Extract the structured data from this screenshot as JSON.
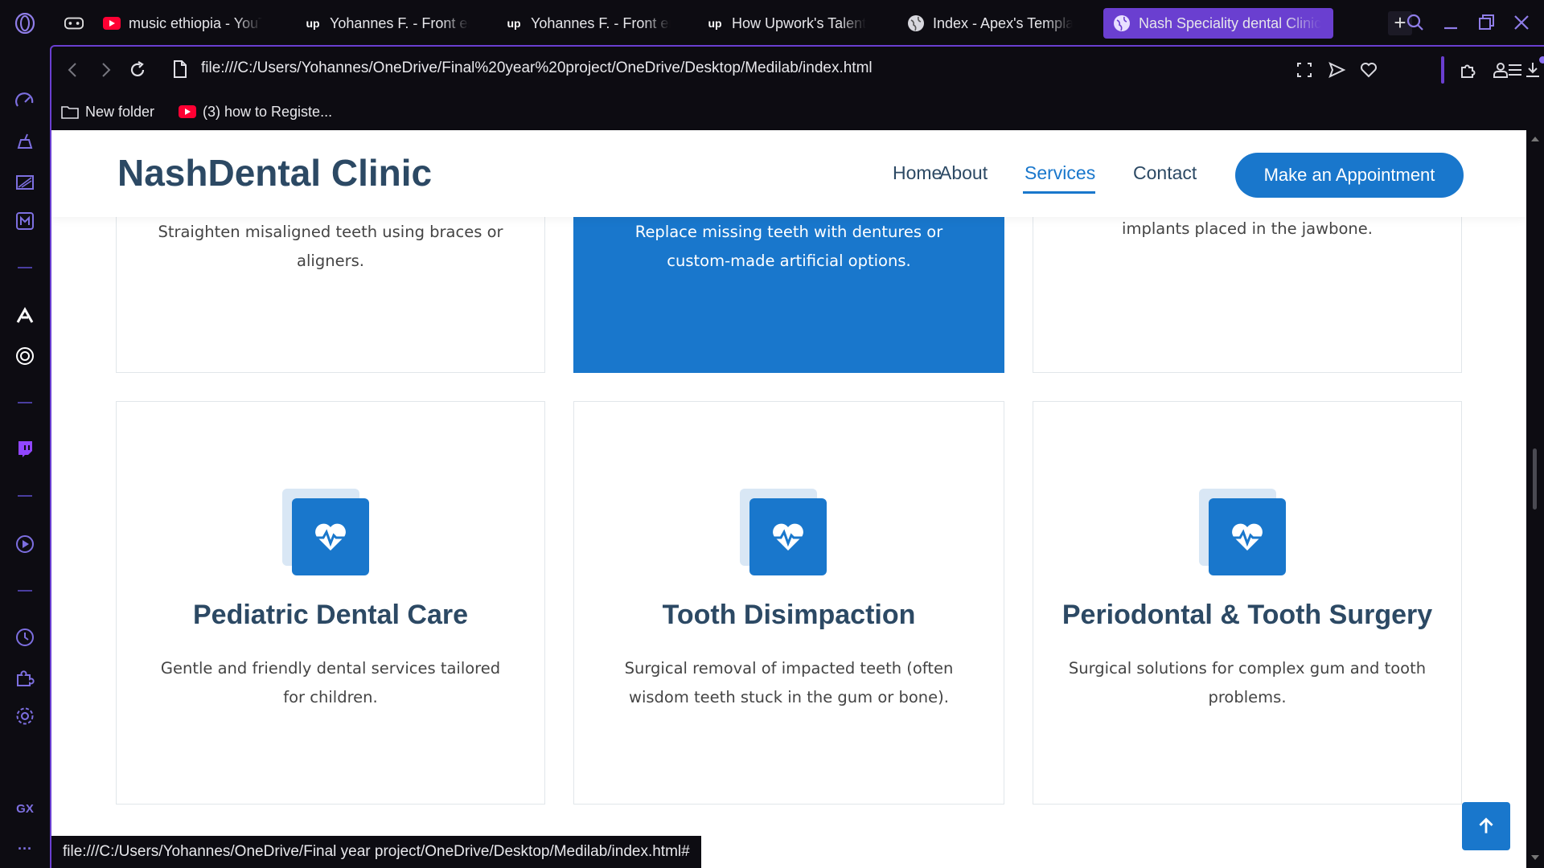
{
  "browser": {
    "tabs": [
      {
        "title": "music ethiopia - YouTube",
        "favicon": "youtube-icon",
        "active": false
      },
      {
        "title": "Yohannes F. - Front end",
        "favicon": "upwork-icon",
        "active": false
      },
      {
        "title": "Yohannes F. - Front end",
        "favicon": "upwork-icon",
        "active": false
      },
      {
        "title": "How Upwork's Talent",
        "favicon": "upwork-icon",
        "active": false
      },
      {
        "title": "Index - Apex's Template",
        "favicon": "globe-icon",
        "active": false
      },
      {
        "title": "Nash Speciality dental Clinic",
        "favicon": "globe-icon",
        "active": true
      }
    ],
    "upwork_glyph": "up",
    "new_tab_label": "+",
    "url": "file:///C:/Users/Yohannes/OneDrive/Final%20year%20project/OneDrive/Desktop/Medilab/index.html",
    "bookmarks": [
      {
        "label": "New folder",
        "icon": "folder-icon"
      },
      {
        "label": "(3) how to Registe...",
        "icon": "youtube-icon"
      }
    ],
    "sidebar_gx_label": "GX",
    "sidebar_more_label": "···",
    "status_url": "file:///C:/Users/Yohannes/OneDrive/Final year project/OneDrive/Desktop/Medilab/index.html#"
  },
  "site": {
    "logo": "NashDental Clinic",
    "nav": [
      {
        "label": "Home",
        "active": false
      },
      {
        "label": "About",
        "active": false
      },
      {
        "label": "Services",
        "active": true
      },
      {
        "label": "Contact",
        "active": false
      }
    ],
    "cta": "Make an Appointment",
    "cards_top": [
      {
        "text": "Straighten misaligned teeth using braces or aligners.",
        "highlight": false
      },
      {
        "text": "Replace missing teeth with dentures or custom-made artificial options.",
        "highlight": true
      },
      {
        "text": "implants placed in the jawbone.",
        "highlight": false
      }
    ],
    "cards_bottom": [
      {
        "title": "Pediatric Dental Care",
        "text": "Gentle and friendly dental services tailored for children.",
        "icon": "heart-pulse-icon"
      },
      {
        "title": "Tooth Disimpaction",
        "text": "Surgical removal of impacted teeth (often wisdom teeth stuck in the gum or bone).",
        "icon": "heart-pulse-icon"
      },
      {
        "title": "Periodontal & Tooth Surgery",
        "text": "Surgical solutions for complex gum and tooth problems.",
        "icon": "heart-pulse-icon"
      }
    ]
  },
  "colors": {
    "accent": "#1977cc",
    "heading": "#2c4964",
    "browser_accent": "#6a3fd0"
  }
}
